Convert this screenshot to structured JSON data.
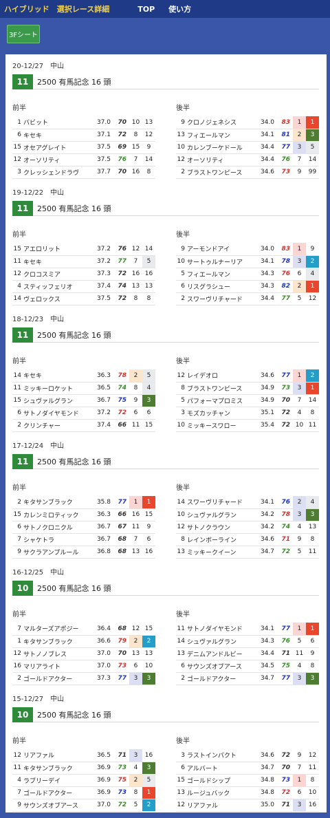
{
  "header": {
    "brand": "ハイブリッド　選択レース詳細",
    "nav_top": "TOP",
    "nav_usage": "使い方"
  },
  "toolbar": {
    "sheet_button": "3Fシート"
  },
  "labels": {
    "first_half": "前半",
    "second_half": "後半"
  },
  "colors": {
    "first": "#e8472e",
    "second": "#249ec9",
    "third": "#4e7d32"
  },
  "races": [
    {
      "date": "20-12/27　中山",
      "race_no": "11",
      "name": "2500 有馬記念 16 頭",
      "first": [
        {
          "no": "1",
          "name": "バビット",
          "f3": "37.0",
          "score": "70",
          "sc": "k",
          "r1": "10",
          "r1c": "",
          "r2": "13",
          "r2c": ""
        },
        {
          "no": "6",
          "name": "キセキ",
          "f3": "37.1",
          "score": "72",
          "sc": "k",
          "r1": "8",
          "r1c": "",
          "r2": "12",
          "r2c": ""
        },
        {
          "no": "15",
          "name": "オセアグレイト",
          "f3": "37.5",
          "score": "69",
          "sc": "k",
          "r1": "15",
          "r1c": "",
          "r2": "9",
          "r2c": ""
        },
        {
          "no": "12",
          "name": "オーソリティ",
          "f3": "37.5",
          "score": "76",
          "sc": "g",
          "r1": "7",
          "r1c": "",
          "r2": "14",
          "r2c": ""
        },
        {
          "no": "3",
          "name": "クレッシェンドラヴ",
          "f3": "37.7",
          "score": "70",
          "sc": "k",
          "r1": "16",
          "r1c": "",
          "r2": "8",
          "r2c": ""
        }
      ],
      "second": [
        {
          "no": "9",
          "name": "クロノジェネシス",
          "f3": "34.0",
          "score": "83",
          "sc": "r",
          "r1": "1",
          "r1c": "pk",
          "r2": "1",
          "r2c": "rd"
        },
        {
          "no": "13",
          "name": "フィエールマン",
          "f3": "34.1",
          "score": "81",
          "sc": "b",
          "r1": "2",
          "r1c": "pe",
          "r2": "3",
          "r2c": "gr"
        },
        {
          "no": "10",
          "name": "カレンブーケドール",
          "f3": "34.4",
          "score": "77",
          "sc": "b",
          "r1": "3",
          "r1c": "lv",
          "r2": "5",
          "r2c": "gy"
        },
        {
          "no": "12",
          "name": "オーソリティ",
          "f3": "34.4",
          "score": "76",
          "sc": "g",
          "r1": "7",
          "r1c": "",
          "r2": "14",
          "r2c": ""
        },
        {
          "no": "2",
          "name": "ブラストワンピース",
          "f3": "34.6",
          "score": "73",
          "sc": "r",
          "r1": "9",
          "r1c": "",
          "r2": "99",
          "r2c": ""
        }
      ]
    },
    {
      "date": "19-12/22　中山",
      "race_no": "11",
      "name": "2500 有馬記念 16 頭",
      "first": [
        {
          "no": "15",
          "name": "アエロリット",
          "f3": "37.2",
          "score": "76",
          "sc": "k",
          "r1": "12",
          "r1c": "",
          "r2": "14",
          "r2c": ""
        },
        {
          "no": "11",
          "name": "キセキ",
          "f3": "37.2",
          "score": "77",
          "sc": "g",
          "r1": "7",
          "r1c": "",
          "r2": "5",
          "r2c": "gy"
        },
        {
          "no": "12",
          "name": "クロコスミア",
          "f3": "37.3",
          "score": "72",
          "sc": "k",
          "r1": "16",
          "r1c": "",
          "r2": "16",
          "r2c": ""
        },
        {
          "no": "4",
          "name": "スティッフェリオ",
          "f3": "37.4",
          "score": "74",
          "sc": "k",
          "r1": "13",
          "r1c": "",
          "r2": "13",
          "r2c": ""
        },
        {
          "no": "14",
          "name": "ヴェロックス",
          "f3": "37.5",
          "score": "72",
          "sc": "k",
          "r1": "8",
          "r1c": "",
          "r2": "8",
          "r2c": ""
        }
      ],
      "second": [
        {
          "no": "9",
          "name": "アーモンドアイ",
          "f3": "34.0",
          "score": "83",
          "sc": "r",
          "r1": "1",
          "r1c": "pk",
          "r2": "9",
          "r2c": ""
        },
        {
          "no": "10",
          "name": "サートゥルナーリア",
          "f3": "34.1",
          "score": "78",
          "sc": "b",
          "r1": "3",
          "r1c": "lv",
          "r2": "2",
          "r2c": "tl"
        },
        {
          "no": "5",
          "name": "フィエールマン",
          "f3": "34.3",
          "score": "76",
          "sc": "r",
          "r1": "6",
          "r1c": "",
          "r2": "4",
          "r2c": "gy"
        },
        {
          "no": "6",
          "name": "リスグラシュー",
          "f3": "34.3",
          "score": "82",
          "sc": "b",
          "r1": "2",
          "r1c": "pe",
          "r2": "1",
          "r2c": "rd"
        },
        {
          "no": "2",
          "name": "スワーヴリチャード",
          "f3": "34.4",
          "score": "77",
          "sc": "g",
          "r1": "5",
          "r1c": "",
          "r2": "12",
          "r2c": ""
        }
      ]
    },
    {
      "date": "18-12/23　中山",
      "race_no": "11",
      "name": "2500 有馬記念 16 頭",
      "first": [
        {
          "no": "14",
          "name": "キセキ",
          "f3": "36.3",
          "score": "78",
          "sc": "r",
          "r1": "2",
          "r1c": "pe",
          "r2": "5",
          "r2c": "gy"
        },
        {
          "no": "11",
          "name": "ミッキーロケット",
          "f3": "36.5",
          "score": "74",
          "sc": "g",
          "r1": "8",
          "r1c": "",
          "r2": "4",
          "r2c": "gy"
        },
        {
          "no": "15",
          "name": "シュヴァルグラン",
          "f3": "36.7",
          "score": "75",
          "sc": "b",
          "r1": "9",
          "r1c": "",
          "r2": "3",
          "r2c": "gr"
        },
        {
          "no": "6",
          "name": "サトノダイヤモンド",
          "f3": "37.2",
          "score": "72",
          "sc": "r",
          "r1": "6",
          "r1c": "",
          "r2": "6",
          "r2c": ""
        },
        {
          "no": "2",
          "name": "クリンチャー",
          "f3": "37.4",
          "score": "66",
          "sc": "k",
          "r1": "11",
          "r1c": "",
          "r2": "15",
          "r2c": ""
        }
      ],
      "second": [
        {
          "no": "12",
          "name": "レイデオロ",
          "f3": "34.6",
          "score": "77",
          "sc": "b",
          "r1": "1",
          "r1c": "pk",
          "r2": "2",
          "r2c": "tl"
        },
        {
          "no": "8",
          "name": "ブラストワンピース",
          "f3": "34.9",
          "score": "73",
          "sc": "g",
          "r1": "3",
          "r1c": "lv",
          "r2": "1",
          "r2c": "rd"
        },
        {
          "no": "5",
          "name": "パフォーマプロミス",
          "f3": "34.9",
          "score": "70",
          "sc": "k",
          "r1": "7",
          "r1c": "",
          "r2": "14",
          "r2c": ""
        },
        {
          "no": "3",
          "name": "モズカッチャン",
          "f3": "35.1",
          "score": "72",
          "sc": "k",
          "r1": "4",
          "r1c": "",
          "r2": "8",
          "r2c": ""
        },
        {
          "no": "10",
          "name": "ミッキースワロー",
          "f3": "35.4",
          "score": "72",
          "sc": "k",
          "r1": "10",
          "r1c": "",
          "r2": "11",
          "r2c": ""
        }
      ]
    },
    {
      "date": "17-12/24　中山",
      "race_no": "11",
      "name": "2500 有馬記念 16 頭",
      "first": [
        {
          "no": "2",
          "name": "キタサンブラック",
          "f3": "35.8",
          "score": "77",
          "sc": "b",
          "r1": "1",
          "r1c": "pk",
          "r2": "1",
          "r2c": "rd"
        },
        {
          "no": "15",
          "name": "カレンミロティック",
          "f3": "36.3",
          "score": "66",
          "sc": "k",
          "r1": "16",
          "r1c": "",
          "r2": "15",
          "r2c": ""
        },
        {
          "no": "6",
          "name": "サトノクロニクル",
          "f3": "36.7",
          "score": "67",
          "sc": "k",
          "r1": "11",
          "r1c": "",
          "r2": "9",
          "r2c": ""
        },
        {
          "no": "7",
          "name": "シャケトラ",
          "f3": "36.7",
          "score": "68",
          "sc": "k",
          "r1": "7",
          "r1c": "",
          "r2": "6",
          "r2c": ""
        },
        {
          "no": "9",
          "name": "サクラアンプルール",
          "f3": "36.8",
          "score": "68",
          "sc": "k",
          "r1": "13",
          "r1c": "",
          "r2": "16",
          "r2c": ""
        }
      ],
      "second": [
        {
          "no": "14",
          "name": "スワーヴリチャード",
          "f3": "34.1",
          "score": "76",
          "sc": "b",
          "r1": "2",
          "r1c": "lv",
          "r2": "4",
          "r2c": "gy"
        },
        {
          "no": "10",
          "name": "シュヴァルグラン",
          "f3": "34.2",
          "score": "78",
          "sc": "r",
          "r1": "3",
          "r1c": "lv",
          "r2": "3",
          "r2c": "gr"
        },
        {
          "no": "12",
          "name": "サトノクラウン",
          "f3": "34.2",
          "score": "74",
          "sc": "g",
          "r1": "4",
          "r1c": "",
          "r2": "13",
          "r2c": ""
        },
        {
          "no": "8",
          "name": "レインボーライン",
          "f3": "34.6",
          "score": "71",
          "sc": "r",
          "r1": "9",
          "r1c": "",
          "r2": "8",
          "r2c": ""
        },
        {
          "no": "13",
          "name": "ミッキークイーン",
          "f3": "34.7",
          "score": "72",
          "sc": "g",
          "r1": "5",
          "r1c": "",
          "r2": "11",
          "r2c": ""
        }
      ]
    },
    {
      "date": "16-12/25　中山",
      "race_no": "10",
      "name": "2500 有馬記念 16 頭",
      "first": [
        {
          "no": "7",
          "name": "マルターズアポジー",
          "f3": "36.4",
          "score": "68",
          "sc": "k",
          "r1": "12",
          "r1c": "",
          "r2": "15",
          "r2c": ""
        },
        {
          "no": "1",
          "name": "キタサンブラック",
          "f3": "36.6",
          "score": "79",
          "sc": "r",
          "r1": "2",
          "r1c": "pe",
          "r2": "2",
          "r2c": "tl"
        },
        {
          "no": "12",
          "name": "サトノノブレス",
          "f3": "37.0",
          "score": "70",
          "sc": "k",
          "r1": "13",
          "r1c": "",
          "r2": "13",
          "r2c": ""
        },
        {
          "no": "16",
          "name": "マリアライト",
          "f3": "37.0",
          "score": "73",
          "sc": "r",
          "r1": "6",
          "r1c": "",
          "r2": "10",
          "r2c": ""
        },
        {
          "no": "2",
          "name": "ゴールドアクター",
          "f3": "37.3",
          "score": "77",
          "sc": "b",
          "r1": "3",
          "r1c": "lv",
          "r2": "3",
          "r2c": "gr"
        }
      ],
      "second": [
        {
          "no": "11",
          "name": "サトノダイヤモンド",
          "f3": "34.1",
          "score": "77",
          "sc": "b",
          "r1": "1",
          "r1c": "pk",
          "r2": "1",
          "r2c": "rd"
        },
        {
          "no": "14",
          "name": "シュヴァルグラン",
          "f3": "34.3",
          "score": "76",
          "sc": "g",
          "r1": "5",
          "r1c": "",
          "r2": "6",
          "r2c": ""
        },
        {
          "no": "13",
          "name": "デニムアンドルビー",
          "f3": "34.4",
          "score": "71",
          "sc": "k",
          "r1": "11",
          "r1c": "",
          "r2": "9",
          "r2c": ""
        },
        {
          "no": "6",
          "name": "サウンズオブアース",
          "f3": "34.5",
          "score": "75",
          "sc": "g",
          "r1": "4",
          "r1c": "",
          "r2": "8",
          "r2c": ""
        },
        {
          "no": "2",
          "name": "ゴールドアクター",
          "f3": "34.7",
          "score": "77",
          "sc": "b",
          "r1": "3",
          "r1c": "lv",
          "r2": "3",
          "r2c": "gr"
        }
      ]
    },
    {
      "date": "15-12/27　中山",
      "race_no": "10",
      "name": "2500 有馬記念 16 頭",
      "first": [
        {
          "no": "12",
          "name": "リアファル",
          "f3": "36.5",
          "score": "71",
          "sc": "k",
          "r1": "3",
          "r1c": "lv",
          "r2": "16",
          "r2c": ""
        },
        {
          "no": "11",
          "name": "キタサンブラック",
          "f3": "36.9",
          "score": "73",
          "sc": "g",
          "r1": "4",
          "r1c": "",
          "r2": "3",
          "r2c": "gr"
        },
        {
          "no": "4",
          "name": "ラブリーデイ",
          "f3": "36.9",
          "score": "75",
          "sc": "r",
          "r1": "2",
          "r1c": "pe",
          "r2": "5",
          "r2c": "gy"
        },
        {
          "no": "7",
          "name": "ゴールドアクター",
          "f3": "36.9",
          "score": "73",
          "sc": "b",
          "r1": "8",
          "r1c": "",
          "r2": "1",
          "r2c": "rd"
        },
        {
          "no": "9",
          "name": "サウンズオブアース",
          "f3": "37.0",
          "score": "72",
          "sc": "g",
          "r1": "5",
          "r1c": "",
          "r2": "2",
          "r2c": "tl"
        }
      ],
      "second": [
        {
          "no": "3",
          "name": "ラストインパクト",
          "f3": "34.6",
          "score": "72",
          "sc": "k",
          "r1": "9",
          "r1c": "",
          "r2": "12",
          "r2c": ""
        },
        {
          "no": "6",
          "name": "アルバート",
          "f3": "34.7",
          "score": "70",
          "sc": "k",
          "r1": "7",
          "r1c": "",
          "r2": "11",
          "r2c": ""
        },
        {
          "no": "15",
          "name": "ゴールドシップ",
          "f3": "34.8",
          "score": "73",
          "sc": "b",
          "r1": "1",
          "r1c": "pk",
          "r2": "8",
          "r2c": ""
        },
        {
          "no": "13",
          "name": "ルージュバック",
          "f3": "34.8",
          "score": "72",
          "sc": "r",
          "r1": "6",
          "r1c": "",
          "r2": "10",
          "r2c": ""
        },
        {
          "no": "12",
          "name": "リアファル",
          "f3": "35.0",
          "score": "71",
          "sc": "k",
          "r1": "3",
          "r1c": "lv",
          "r2": "16",
          "r2c": ""
        }
      ]
    }
  ]
}
